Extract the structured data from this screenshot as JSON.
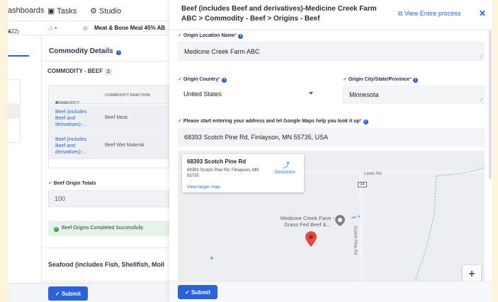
{
  "background_app": {
    "nav": {
      "dashboards": "ashboards",
      "tasks": "Tasks",
      "studio": "Studio"
    },
    "subbar": {
      "count": "422)",
      "product": "Meat & Bone Meal 45% AB"
    },
    "panel": {
      "title": "Commodity Details",
      "subtitle": "COMMODITY - BEEF",
      "subtitle_count": "2",
      "table": {
        "headers": [
          "COMMODITY",
          "COMMODITY FRACTION"
        ],
        "rows": [
          {
            "commodity": "Beef (includes Beef and derivatives)-...",
            "fraction": "Beef Meat"
          },
          {
            "commodity": "Beef (includes Beef and derivatives)-...",
            "fraction": "Beef Wet Material"
          }
        ]
      },
      "totals_label": "Beef Origin Totals",
      "totals_value": "100",
      "success_message": "Beef Origins Completed Successfully",
      "next_section": "Seafood (includes Fish, Shellfish, Moll"
    },
    "submit_label": "Submit"
  },
  "drawer": {
    "title": "Beef (includes Beef and derivatives)-Medicine Creek Farm ABC > Commodity - Beef > Origins - Beef",
    "view_entire_process": "View Entire process",
    "fields": {
      "location_name": {
        "label": "Origin Location Name",
        "value": "Medicine Creek Farm ABC"
      },
      "country": {
        "label": "Origin Country",
        "value": "United States"
      },
      "city_state": {
        "label": "Origin City/State/Province",
        "value": "Minnesota"
      },
      "address": {
        "label": "Please start entering your address and let Google Maps help you look it up",
        "value": "68393 Scotch Pine Rd, Finlayson, MN 55735, USA"
      }
    },
    "map": {
      "card_title": "68393 Scotch Pine Rd",
      "card_address": "68393 Scotch Pine Rd, Finlayson, MN 55735",
      "directions": "Directions",
      "view_larger": "View larger map",
      "road_lewis": "Lewis Rd",
      "hw_number": "34",
      "road_scotch": "Scotch Pine Rd",
      "poi_name": "Medicine Creek Farm - Grass Fed Beef &...",
      "zoom_in": "+"
    },
    "submit_label": "Submit"
  },
  "colors": {
    "accent": "#2962d9",
    "success": "#3aa64c",
    "marker": "#e04a3f",
    "frame": "#fbf3dc"
  }
}
